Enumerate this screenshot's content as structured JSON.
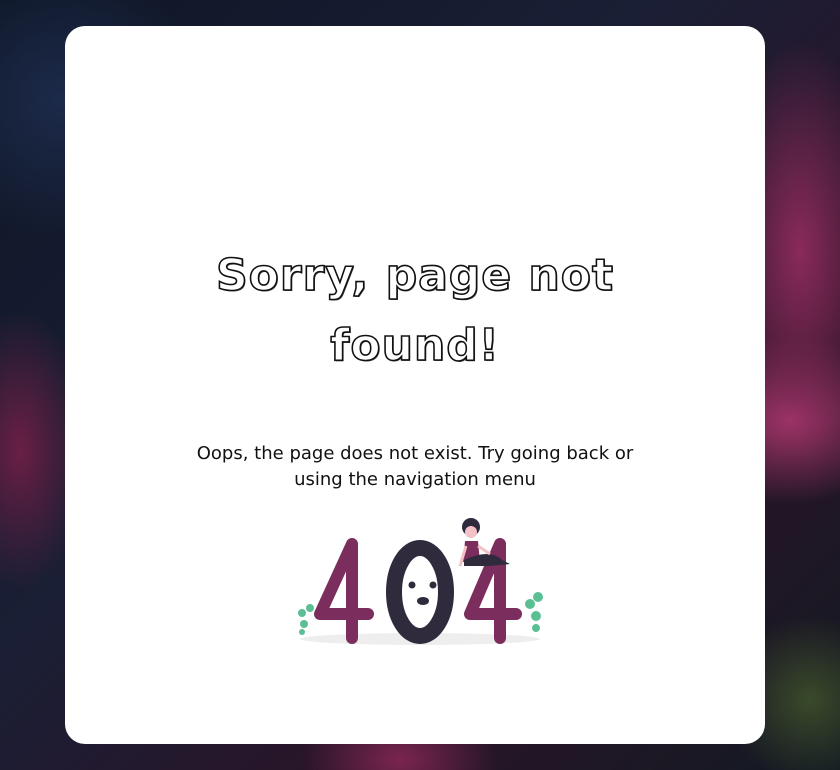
{
  "error_page": {
    "title": "Sorry, page not found!",
    "message": "Oops, the page does not exist. Try going back or using the navigation menu",
    "illustration_text": "404",
    "colors": {
      "accent": "#7b2e5d",
      "dark": "#2f2b3d",
      "leaf": "#5bbf94",
      "card": "#ffffff"
    }
  }
}
